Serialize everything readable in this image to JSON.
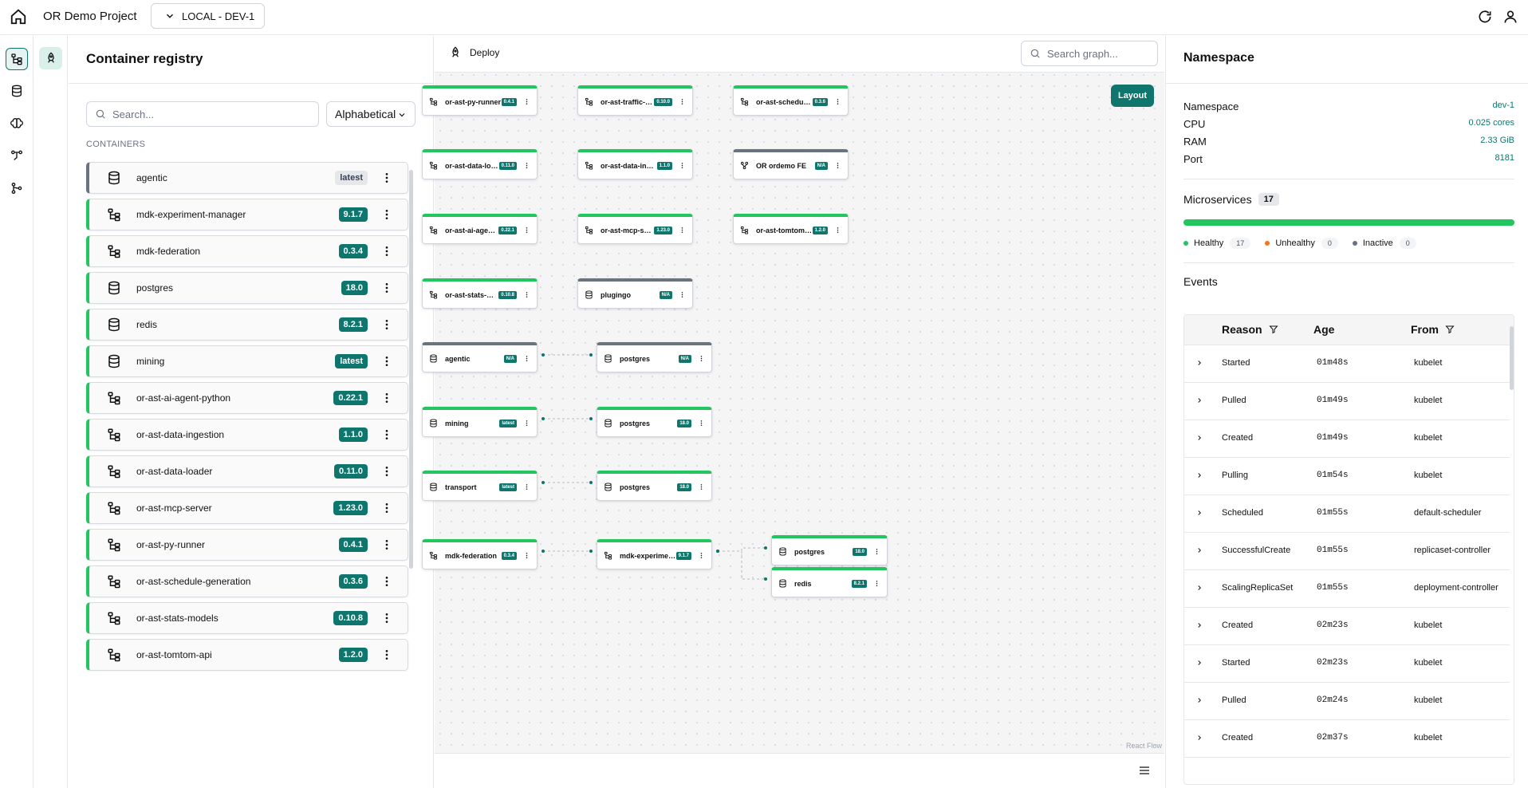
{
  "topbar": {
    "project": "OR Demo Project",
    "environment": "LOCAL - DEV-1"
  },
  "registry": {
    "title": "Container registry",
    "search_placeholder": "Search...",
    "sort": "Alphabetical",
    "section": "CONTAINERS",
    "items": [
      {
        "name": "agentic",
        "version": "latest",
        "kind": "db",
        "status": "inactive"
      },
      {
        "name": "mdk-experiment-manager",
        "version": "9.1.7",
        "kind": "service",
        "status": "healthy"
      },
      {
        "name": "mdk-federation",
        "version": "0.3.4",
        "kind": "service",
        "status": "healthy"
      },
      {
        "name": "postgres",
        "version": "18.0",
        "kind": "db",
        "status": "healthy"
      },
      {
        "name": "redis",
        "version": "8.2.1",
        "kind": "db",
        "status": "healthy"
      },
      {
        "name": "mining",
        "version": "latest",
        "kind": "db",
        "status": "healthy"
      },
      {
        "name": "or-ast-ai-agent-python",
        "version": "0.22.1",
        "kind": "service",
        "status": "healthy"
      },
      {
        "name": "or-ast-data-ingestion",
        "version": "1.1.0",
        "kind": "service",
        "status": "healthy"
      },
      {
        "name": "or-ast-data-loader",
        "version": "0.11.0",
        "kind": "service",
        "status": "healthy"
      },
      {
        "name": "or-ast-mcp-server",
        "version": "1.23.0",
        "kind": "service",
        "status": "healthy"
      },
      {
        "name": "or-ast-py-runner",
        "version": "0.4.1",
        "kind": "service",
        "status": "healthy"
      },
      {
        "name": "or-ast-schedule-generation",
        "version": "0.3.6",
        "kind": "service",
        "status": "healthy"
      },
      {
        "name": "or-ast-stats-models",
        "version": "0.10.8",
        "kind": "service",
        "status": "healthy"
      },
      {
        "name": "or-ast-tomtom-api",
        "version": "1.2.0",
        "kind": "service",
        "status": "healthy"
      }
    ]
  },
  "graph": {
    "deploy_label": "Deploy",
    "search_placeholder": "Search graph...",
    "layout_label": "Layout",
    "attribution": "React Flow",
    "nodes": [
      {
        "name": "or-ast-py-runner",
        "version": "0.4.1",
        "kind": "service",
        "status": "healthy"
      },
      {
        "name": "or-ast-traffic-model",
        "version": "0.10.0",
        "kind": "service",
        "status": "healthy"
      },
      {
        "name": "or-ast-schedule-generation",
        "version": "0.3.6",
        "kind": "service",
        "status": "healthy"
      },
      {
        "name": "or-ast-data-loader",
        "version": "0.11.0",
        "kind": "service",
        "status": "healthy"
      },
      {
        "name": "or-ast-data-ingestion",
        "version": "1.1.0",
        "kind": "service",
        "status": "healthy"
      },
      {
        "name": "OR ordemo FE",
        "version": "N/A",
        "kind": "frontend",
        "status": "inactive"
      },
      {
        "name": "or-ast-ai-agent-python",
        "version": "0.22.1",
        "kind": "service",
        "status": "healthy"
      },
      {
        "name": "or-ast-mcp-server",
        "version": "1.23.0",
        "kind": "service",
        "status": "healthy"
      },
      {
        "name": "or-ast-tomtom-api",
        "version": "1.2.0",
        "kind": "service",
        "status": "healthy"
      },
      {
        "name": "or-ast-stats-models",
        "version": "0.10.8",
        "kind": "service",
        "status": "healthy"
      },
      {
        "name": "plugingo",
        "version": "N/A",
        "kind": "db",
        "status": "inactive"
      },
      {
        "name": "agentic",
        "version": "N/A",
        "kind": "db",
        "status": "inactive"
      },
      {
        "name": "postgres",
        "version": "N/A",
        "kind": "db",
        "status": "inactive"
      },
      {
        "name": "mining",
        "version": "latest",
        "kind": "db",
        "status": "healthy"
      },
      {
        "name": "postgres",
        "version": "18.0",
        "kind": "db",
        "status": "healthy"
      },
      {
        "name": "transport",
        "version": "latest",
        "kind": "db",
        "status": "healthy"
      },
      {
        "name": "postgres",
        "version": "18.0",
        "kind": "db",
        "status": "healthy"
      },
      {
        "name": "mdk-federation",
        "version": "0.3.4",
        "kind": "service",
        "status": "healthy"
      },
      {
        "name": "mdk-experiment-manager",
        "version": "9.1.7",
        "kind": "service",
        "status": "healthy"
      },
      {
        "name": "postgres",
        "version": "18.0",
        "kind": "db",
        "status": "healthy"
      },
      {
        "name": "redis",
        "version": "8.2.1",
        "kind": "db",
        "status": "healthy"
      }
    ]
  },
  "namespace": {
    "title": "Namespace",
    "rows": [
      {
        "label": "Namespace",
        "value": "dev-1"
      },
      {
        "label": "CPU",
        "value": "0.025 cores"
      },
      {
        "label": "RAM",
        "value": "2.33 GiB"
      },
      {
        "label": "Port",
        "value": "8181"
      }
    ],
    "microservices_label": "Microservices",
    "microservices_count": "17",
    "healthy_fraction": 1.0,
    "legend": [
      {
        "label": "Healthy",
        "count": "17",
        "color": "#22c55e"
      },
      {
        "label": "Unhealthy",
        "count": "0",
        "color": "#f97316"
      },
      {
        "label": "Inactive",
        "count": "0",
        "color": "#6b7280"
      }
    ],
    "events_title": "Events",
    "events_columns": {
      "reason": "Reason",
      "age": "Age",
      "from": "From"
    },
    "events": [
      {
        "reason": "Started",
        "age": "01m48s",
        "from": "kubelet"
      },
      {
        "reason": "Pulled",
        "age": "01m49s",
        "from": "kubelet"
      },
      {
        "reason": "Created",
        "age": "01m49s",
        "from": "kubelet"
      },
      {
        "reason": "Pulling",
        "age": "01m54s",
        "from": "kubelet"
      },
      {
        "reason": "Scheduled",
        "age": "01m55s",
        "from": "default-scheduler"
      },
      {
        "reason": "SuccessfulCreate",
        "age": "01m55s",
        "from": "replicaset-controller"
      },
      {
        "reason": "ScalingReplicaSet",
        "age": "01m55s",
        "from": "deployment-controller"
      },
      {
        "reason": "Created",
        "age": "02m23s",
        "from": "kubelet"
      },
      {
        "reason": "Started",
        "age": "02m23s",
        "from": "kubelet"
      },
      {
        "reason": "Pulled",
        "age": "02m24s",
        "from": "kubelet"
      },
      {
        "reason": "Created",
        "age": "02m37s",
        "from": "kubelet"
      }
    ]
  },
  "colors": {
    "accent": "#0f766e",
    "healthy": "#22c55e",
    "unhealthy": "#f97316",
    "inactive": "#6b7280"
  }
}
